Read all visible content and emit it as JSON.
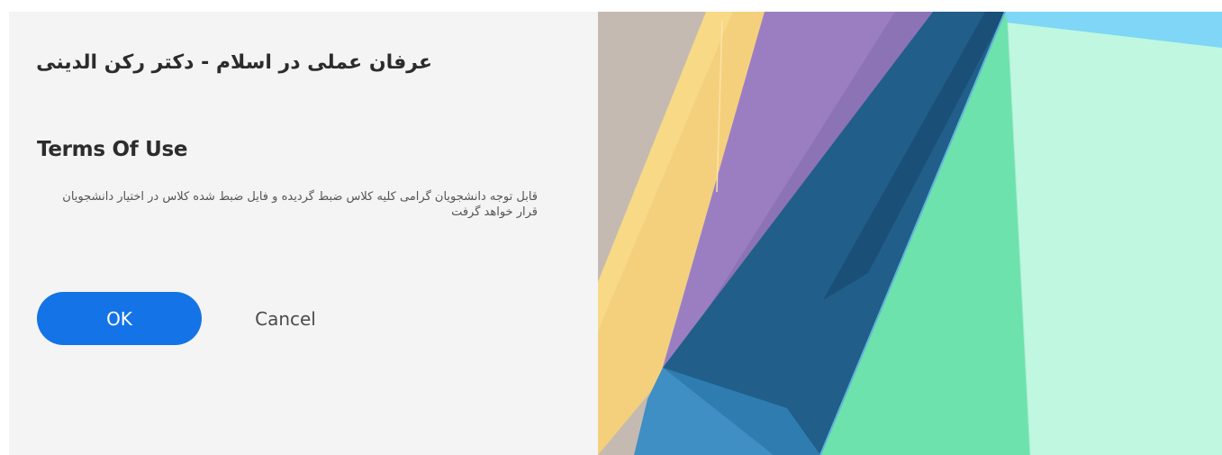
{
  "dialog": {
    "room_title": "عرفان عملی در اسلام - دکتر رکن الدینی",
    "heading": "Terms Of Use",
    "body_text": "قابل توجه دانشجویان گرامی کلیه کلاس ضبط گردیده و فایل ضبط شده کلاس در اختیار دانشجویان قرار خواهد گرفت",
    "ok_label": "OK",
    "cancel_label": "Cancel"
  },
  "colors": {
    "panel_background": "#f4f4f4",
    "primary_button": "#1473e6",
    "primary_button_text": "#ffffff",
    "cancel_text": "#4b4b4b"
  }
}
